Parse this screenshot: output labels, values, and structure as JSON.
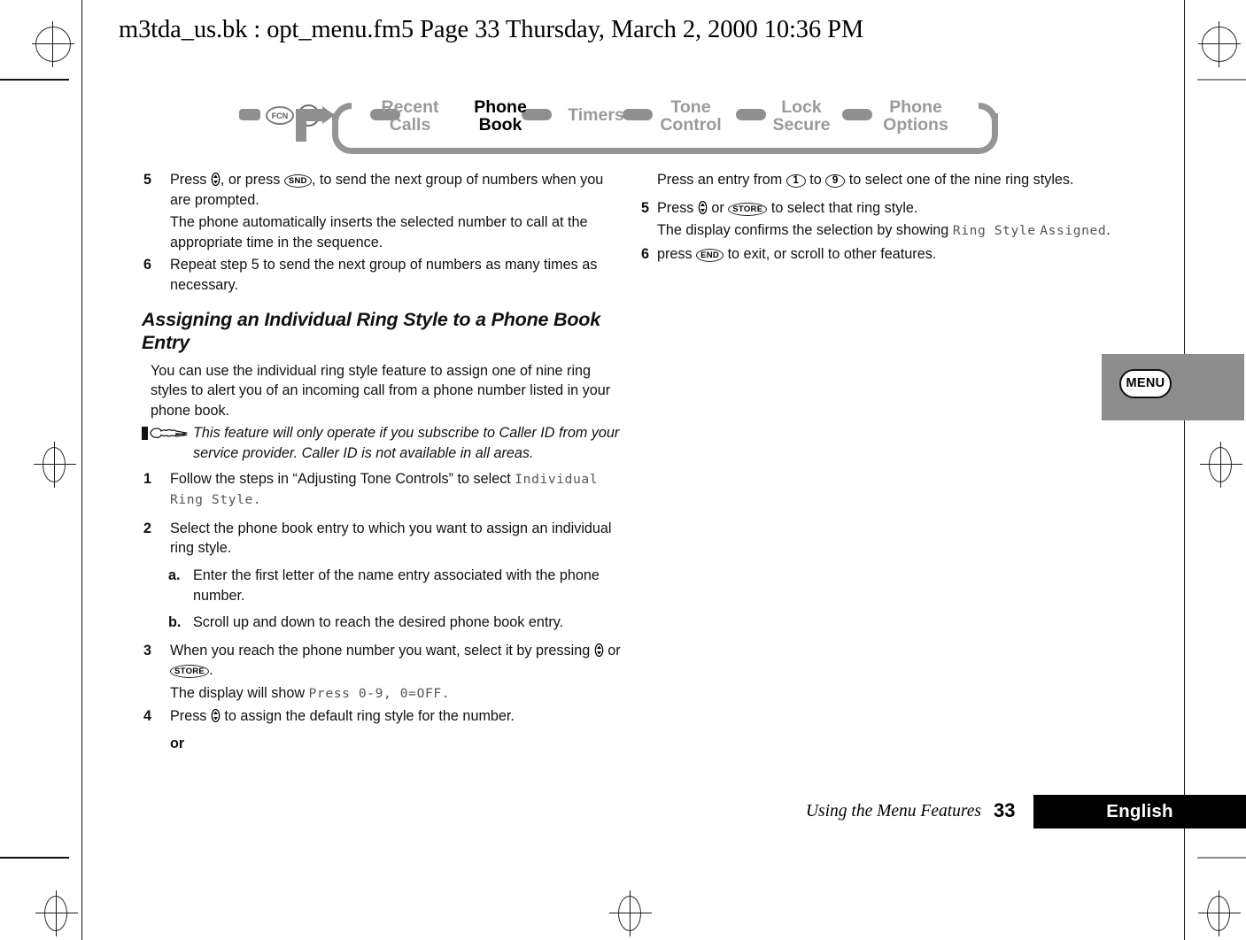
{
  "header": {
    "running_header": "m3tda_us.bk : opt_menu.fm5  Page 33  Thursday, March 2, 2000  10:36 PM"
  },
  "nav": {
    "fcn_key": "FCN",
    "num_key": "1",
    "items": [
      {
        "line1": "Recent",
        "line2": "Calls",
        "active": false
      },
      {
        "line1": "Phone",
        "line2": "Book",
        "active": true
      },
      {
        "line1": "Timers",
        "line2": "",
        "active": false
      },
      {
        "line1": "Tone",
        "line2": "Control",
        "active": false
      },
      {
        "line1": "Lock",
        "line2": "Secure",
        "active": false
      },
      {
        "line1": "Phone",
        "line2": "Options",
        "active": false
      }
    ]
  },
  "left_column": {
    "step5_num": "5",
    "step5_a": "Press",
    "step5_b": ", or press",
    "step5_key_snd": "SND",
    "step5_c": ", to send the next group of numbers when you are prompted.",
    "step5_result": "The phone automatically inserts the selected number to call at the appropriate time in the sequence.",
    "step6_num": "6",
    "step6_text": "Repeat step 5 to send the next group of numbers as many times as necessary.",
    "section_heading": "Assigning an Individual Ring Style to a Phone Book Entry",
    "intro": "You can use the individual ring style feature to assign one of nine ring styles to alert you of an incoming call from a phone number listed in your phone book.",
    "note": "This feature will only operate if you subscribe to Caller ID from your service provider. Caller ID is not available in all areas.",
    "step1_num": "1",
    "step1_text": "Follow the steps in “Adjusting Tone Controls”  to select",
    "step1_lcd": "Individual Ring Style.",
    "step2_num": "2",
    "step2_text": "Select the phone book entry to which you want to assign an individual ring style.",
    "step2a_alpha": "a.",
    "step2a_text": "Enter the first letter of the name entry associated with the phone number.",
    "step2b_alpha": "b.",
    "step2b_text": "Scroll up and down to reach the desired phone book entry.",
    "step3_num": "3",
    "step3_a": "When you reach the phone number you want, select it by pressing",
    "step3_b": "or",
    "step3_key_store": "STORE",
    "step3_c": ".",
    "step3_result_a": "The display will show",
    "step3_result_lcd": "Press 0-9, 0=OFF.",
    "step4_num": "4",
    "step4_a": "Press",
    "step4_b": "to assign the default ring style for the number.",
    "or_label": "or"
  },
  "right_column": {
    "intro_a": "Press an entry from",
    "intro_key_1": "1",
    "intro_b": "to",
    "intro_key_9": "9",
    "intro_c": "to select one of the nine ring styles.",
    "step5_num": "5",
    "step5_a": "Press",
    "step5_b": "or",
    "step5_key_store": "STORE",
    "step5_c": "to select that ring style.",
    "step5_result_a": "The display confirms the selection by showing",
    "step5_result_lcd_1": "Ring Style",
    "step5_result_lcd_2": "Assigned",
    "step5_result_b": ".",
    "step6_num": "6",
    "step6_a": "press",
    "step6_key_end": "END",
    "step6_b": "to exit, or scroll to other features."
  },
  "side_tab": {
    "label": "MENU"
  },
  "footer": {
    "title": "Using the Menu Features",
    "page": "33",
    "language": "English"
  },
  "colors": {
    "nav_gray": "#959595",
    "nav_label_gray": "#9a9a9a",
    "tab_gray": "#8d8d8d",
    "lcd_gray": "#555555",
    "ink": "#000000"
  }
}
